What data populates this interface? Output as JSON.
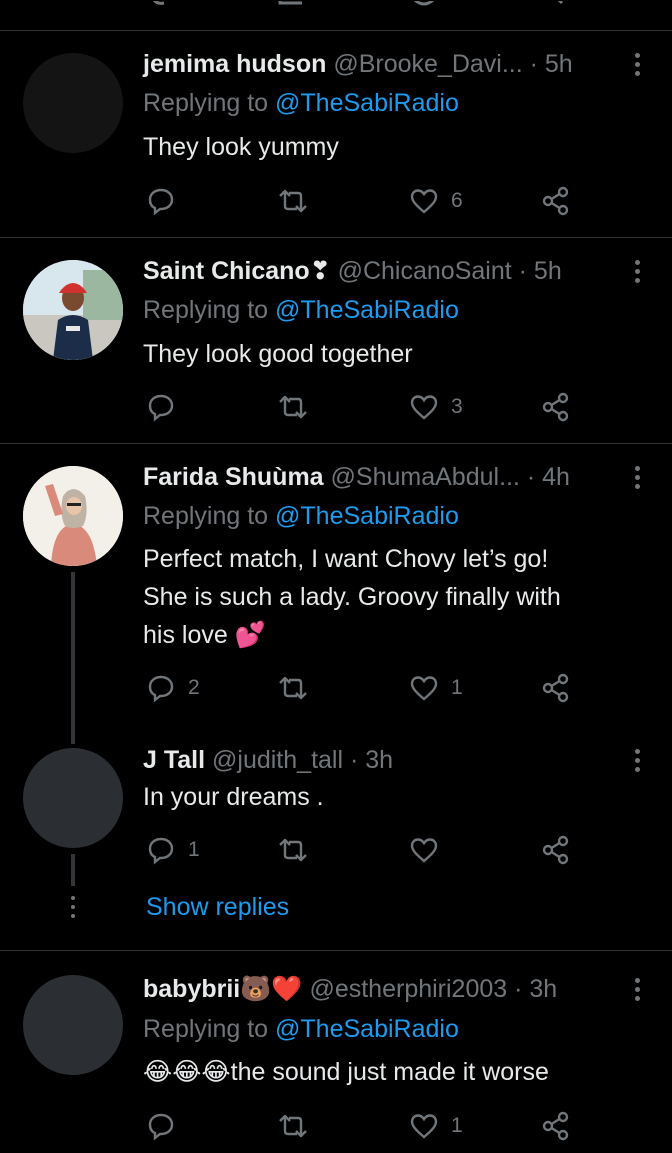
{
  "top_partial": {
    "description_icons": [
      "reply-icon",
      "retweet-icon",
      "like-icon"
    ]
  },
  "tweets": [
    {
      "name": "jemima hudson",
      "handle": "@Brooke_Davi...",
      "time": "5h",
      "replying_prefix": "Replying to ",
      "replying_to": "@TheSabiRadio",
      "text": "They look yummy",
      "replies": "",
      "likes": "6"
    },
    {
      "name": "Saint Chicano",
      "name_emoji": "❣",
      "handle": "@ChicanoSaint",
      "time": "5h",
      "replying_prefix": "Replying to ",
      "replying_to": "@TheSabiRadio",
      "text": "They look good together",
      "replies": "",
      "likes": "3"
    },
    {
      "name": "Farida Shuùma",
      "handle": "@ShumaAbdul...",
      "time": "4h",
      "replying_prefix": "Replying to ",
      "replying_to": "@TheSabiRadio",
      "text_lines": [
        "Perfect match, I want Chovy let’s go!",
        "She is such a lady. Groovy finally with",
        "his love 💕"
      ],
      "replies": "2",
      "likes": "1"
    },
    {
      "name": "J Tall",
      "handle": "@judith_tall",
      "time": "3h",
      "text": "In your dreams .",
      "replies": "1",
      "likes": ""
    },
    {
      "name": "babybrii🐻❤️",
      "handle": "@estherphiri2003",
      "time": "3h",
      "replying_prefix": "Replying to ",
      "replying_to": "@TheSabiRadio",
      "text": "😂😂😂the sound just made it worse",
      "replies": "",
      "likes": "1"
    }
  ],
  "show_replies_label": "Show replies",
  "colors": {
    "background": "#000000",
    "accent": "#1d9bf0",
    "muted": "#71767b",
    "text": "#e7e9ea",
    "divider": "#2f3336"
  }
}
